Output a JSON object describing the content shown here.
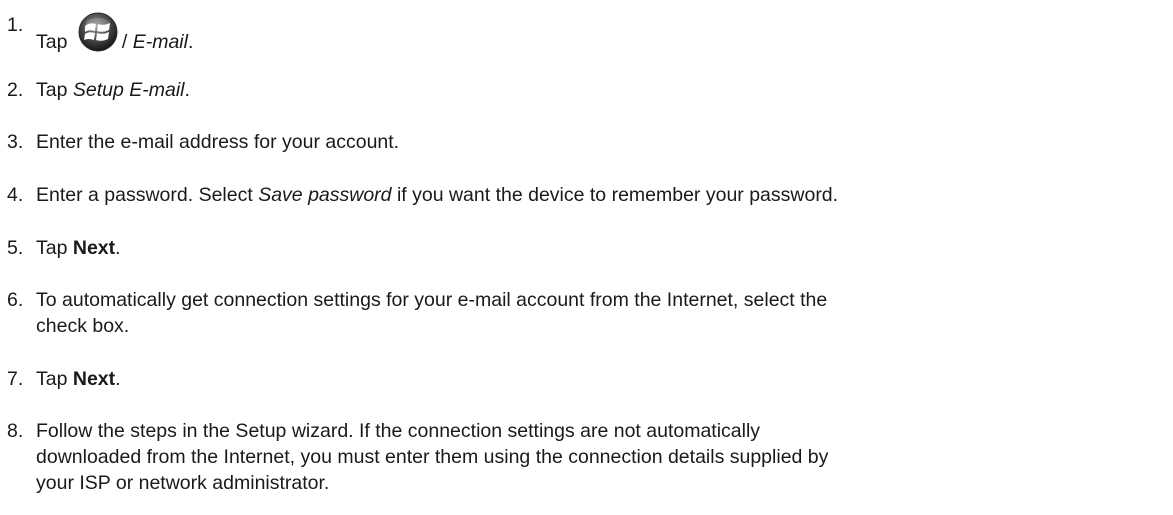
{
  "steps": [
    {
      "number": "1.",
      "parts": [
        {
          "text": "Tap ",
          "style": "normal"
        },
        {
          "icon": "windows-start-icon"
        },
        {
          "text": "/ ",
          "style": "normal"
        },
        {
          "text": "E-mail",
          "style": "italic"
        },
        {
          "text": ".",
          "style": "normal"
        }
      ]
    },
    {
      "number": "2.",
      "parts": [
        {
          "text": "Tap ",
          "style": "normal"
        },
        {
          "text": "Setup E-mail",
          "style": "italic"
        },
        {
          "text": ".",
          "style": "normal"
        }
      ]
    },
    {
      "number": "3.",
      "parts": [
        {
          "text": "Enter the e-mail address for your account.",
          "style": "normal"
        }
      ]
    },
    {
      "number": "4.",
      "parts": [
        {
          "text": "Enter a password. Select ",
          "style": "normal"
        },
        {
          "text": "Save password",
          "style": "italic"
        },
        {
          "text": " if you want the device to remember your password.",
          "style": "normal"
        }
      ]
    },
    {
      "number": "5.",
      "parts": [
        {
          "text": "Tap ",
          "style": "normal"
        },
        {
          "text": "Next",
          "style": "bold"
        },
        {
          "text": ".",
          "style": "normal"
        }
      ]
    },
    {
      "number": "6.",
      "lines": [
        "To automatically get connection settings for your e-mail account from the Internet, select the",
        "check box."
      ]
    },
    {
      "number": "7.",
      "parts": [
        {
          "text": "Tap ",
          "style": "normal"
        },
        {
          "text": "Next",
          "style": "bold"
        },
        {
          "text": ".",
          "style": "normal"
        }
      ]
    },
    {
      "number": "8.",
      "lines": [
        "Follow the steps in the Setup wizard. If the connection settings are not automatically",
        "downloaded from the Internet, you must enter them using the connection details supplied by",
        "your ISP or network administrator."
      ]
    }
  ]
}
